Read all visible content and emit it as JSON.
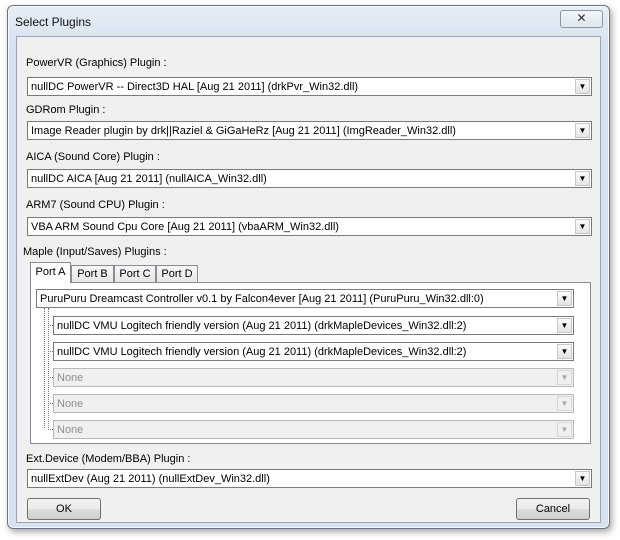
{
  "window": {
    "title": "Select Plugins",
    "close_glyph": "✕"
  },
  "pvr": {
    "label": "PowerVR (Graphics) Plugin :",
    "value": "nullDC PowerVR -- Direct3D HAL [Aug 21 2011] (drkPvr_Win32.dll)"
  },
  "gdrom": {
    "label": "GDRom Plugin :",
    "value": "Image Reader plugin by drk||Raziel & GiGaHeRz [Aug 21 2011] (ImgReader_Win32.dll)"
  },
  "aica": {
    "label": "AICA (Sound Core) Plugin :",
    "value": "nullDC AICA [Aug 21 2011] (nullAICA_Win32.dll)"
  },
  "arm7": {
    "label": "ARM7 (Sound CPU) Plugin :",
    "value": "VBA ARM Sound Cpu Core [Aug 21 2011] (vbaARM_Win32.dll)"
  },
  "maple": {
    "label": "Maple (Input/Saves) Plugins :",
    "tabs": [
      "Port A",
      "Port B",
      "Port C",
      "Port D"
    ],
    "active_tab": "Port A",
    "main_device": "PuruPuru Dreamcast Controller v0.1 by Falcon4ever [Aug 21 2011] (PuruPuru_Win32.dll:0)",
    "subdevices": [
      "nullDC VMU Logitech friendly version (Aug 21 2011) (drkMapleDevices_Win32.dll:2)",
      "nullDC VMU Logitech friendly version (Aug 21 2011) (drkMapleDevices_Win32.dll:2)",
      "None",
      "None",
      "None"
    ]
  },
  "extdev": {
    "label": "Ext.Device (Modem/BBA) Plugin :",
    "value": "nullExtDev (Aug 21 2011) (nullExtDev_Win32.dll)"
  },
  "buttons": {
    "ok": "OK",
    "cancel": "Cancel"
  },
  "dropdown_glyph": "▼"
}
